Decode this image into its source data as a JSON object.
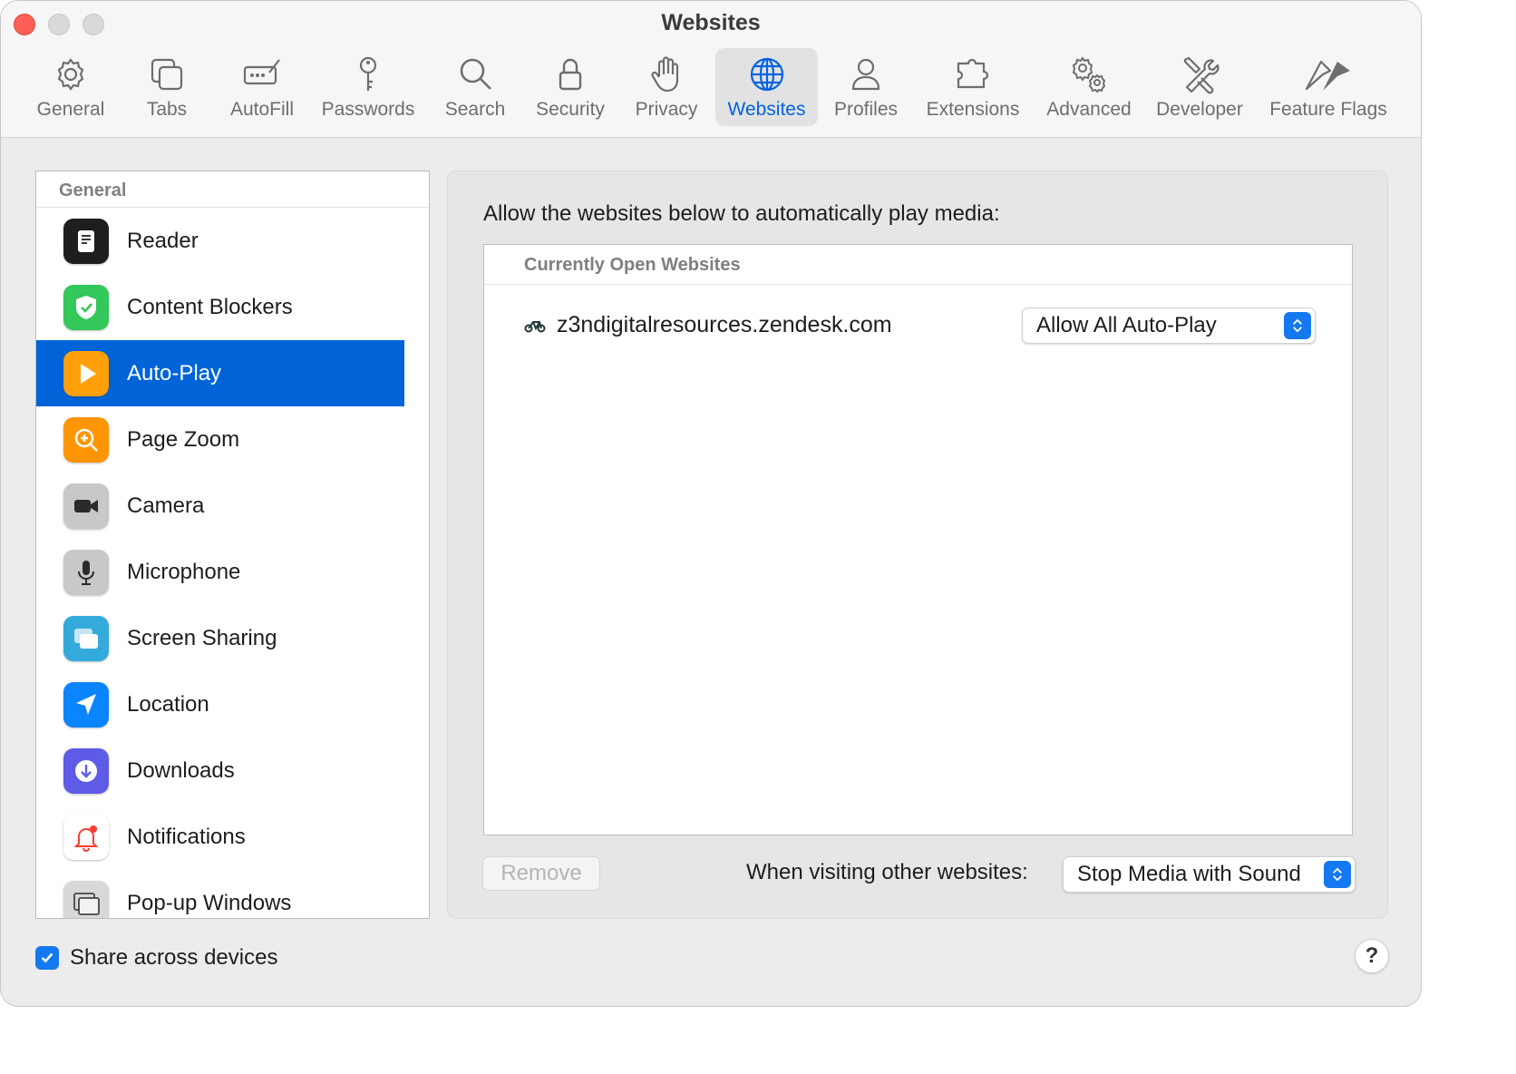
{
  "window": {
    "title": "Websites"
  },
  "toolbar": {
    "tabs": [
      {
        "label": "General",
        "icon": "gear-icon"
      },
      {
        "label": "Tabs",
        "icon": "tabs-icon"
      },
      {
        "label": "AutoFill",
        "icon": "autofill-icon"
      },
      {
        "label": "Passwords",
        "icon": "key-icon"
      },
      {
        "label": "Search",
        "icon": "magnifier-icon"
      },
      {
        "label": "Security",
        "icon": "lock-icon"
      },
      {
        "label": "Privacy",
        "icon": "hand-icon"
      },
      {
        "label": "Websites",
        "icon": "globe-icon",
        "active": true
      },
      {
        "label": "Profiles",
        "icon": "person-icon"
      },
      {
        "label": "Extensions",
        "icon": "puzzle-icon"
      },
      {
        "label": "Advanced",
        "icon": "gears-icon"
      },
      {
        "label": "Developer",
        "icon": "tools-icon"
      },
      {
        "label": "Feature Flags",
        "icon": "flags-icon"
      }
    ],
    "accent": "#0063e1"
  },
  "sidebar": {
    "header": "General",
    "items": [
      {
        "label": "Reader",
        "icon": "reader-icon"
      },
      {
        "label": "Content Blockers",
        "icon": "shield-check-icon"
      },
      {
        "label": "Auto-Play",
        "icon": "play-icon",
        "selected": true
      },
      {
        "label": "Page Zoom",
        "icon": "zoom-icon"
      },
      {
        "label": "Camera",
        "icon": "camera-icon"
      },
      {
        "label": "Microphone",
        "icon": "microphone-icon"
      },
      {
        "label": "Screen Sharing",
        "icon": "screen-sharing-icon"
      },
      {
        "label": "Location",
        "icon": "location-arrow-icon"
      },
      {
        "label": "Downloads",
        "icon": "download-icon"
      },
      {
        "label": "Notifications",
        "icon": "bell-icon"
      },
      {
        "label": "Pop-up Windows",
        "icon": "popup-windows-icon"
      }
    ],
    "selection_color": "#0064d9"
  },
  "main": {
    "heading": "Allow the websites below to automatically play media:",
    "table_header": "Currently Open Websites",
    "sites": [
      {
        "name": "z3ndigitalresources.zendesk.com",
        "setting": "Allow All Auto-Play",
        "favicon": "bicycle-icon"
      }
    ],
    "remove_label": "Remove",
    "other_label": "When visiting other websites:",
    "other_value": "Stop Media with Sound"
  },
  "footer": {
    "share_label": "Share across devices",
    "share_checked": true,
    "help_label": "?"
  }
}
